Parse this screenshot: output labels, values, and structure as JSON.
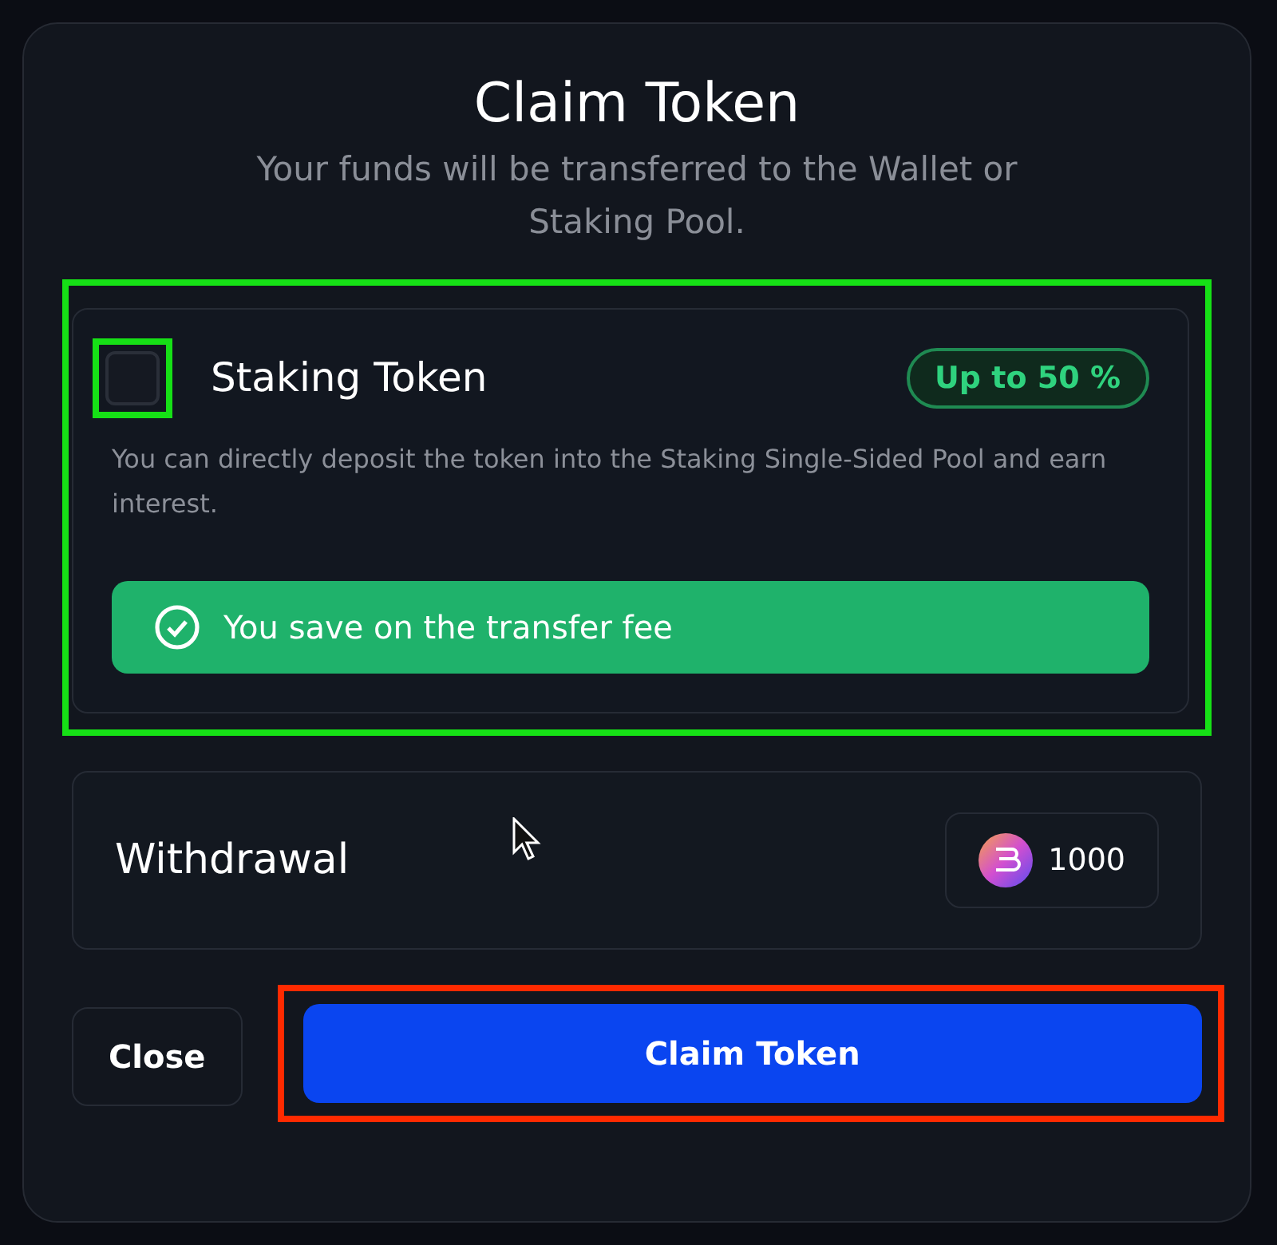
{
  "modal": {
    "title": "Claim Token",
    "subtitle": "Your funds will be transferred to the Wallet or Staking Pool."
  },
  "staking_option": {
    "checked": false,
    "title": "Staking Token",
    "badge": "Up to 50 %",
    "description": "You can directly deposit the token into the Staking Single-Sided Pool and earn interest.",
    "notice": "You save on the transfer fee",
    "highlighted": true
  },
  "withdrawal": {
    "label": "Withdrawal",
    "amount": "1000"
  },
  "buttons": [
    {
      "label": "Close",
      "kind": "secondary"
    },
    {
      "label": "Claim Token",
      "kind": "primary",
      "highlighted": true
    }
  ]
}
